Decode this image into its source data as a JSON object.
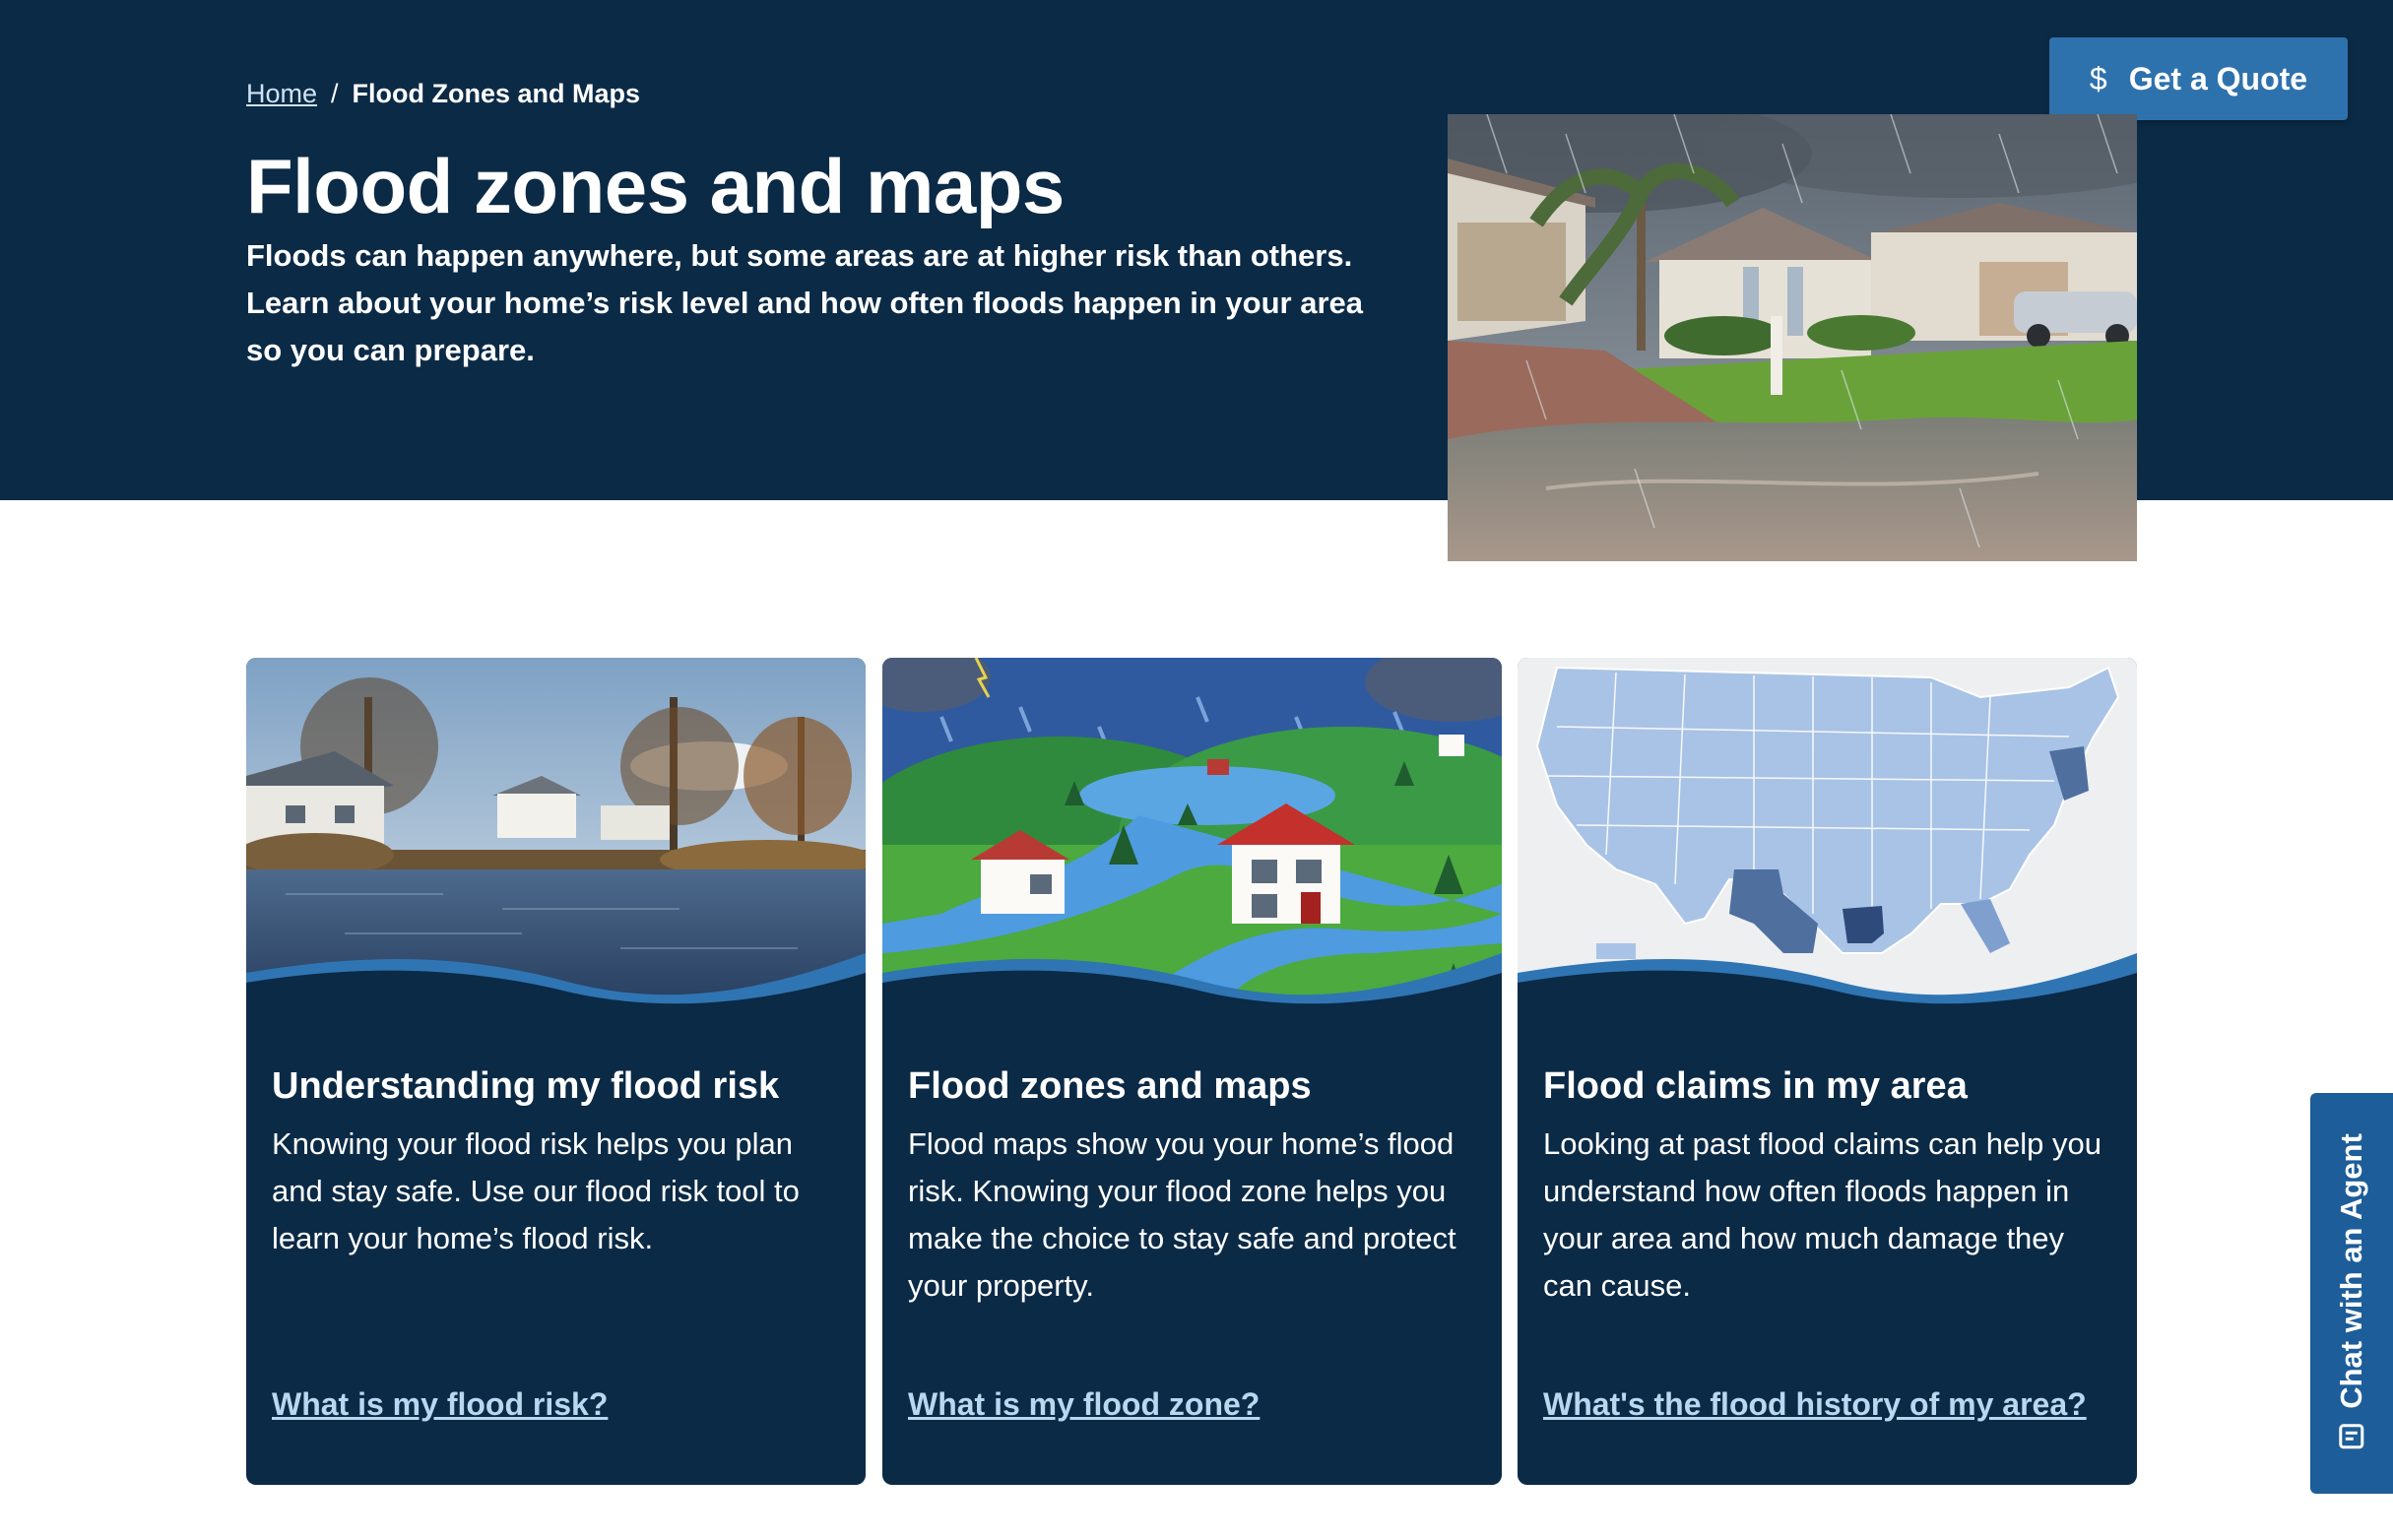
{
  "breadcrumb": {
    "home": "Home",
    "separator": "/",
    "current": "Flood Zones and Maps"
  },
  "hero": {
    "title": "Flood zones and maps",
    "description": "Floods can happen anywhere, but some areas are at higher risk than others. Learn about your home’s risk level and how often floods happen in your area so you can prepare."
  },
  "quote_button": {
    "label": "Get a Quote",
    "icon": "dollar-icon"
  },
  "cards": [
    {
      "title": "Understanding my flood risk",
      "body": "Knowing your flood risk helps you plan and stay safe. Use our flood risk tool to learn your home’s flood risk.",
      "link": "What is my flood risk?"
    },
    {
      "title": "Flood zones and maps",
      "body": "Flood maps show you your home’s flood risk. Knowing your flood zone helps you make the choice to stay safe and protect your property.",
      "link": "What is my flood zone?"
    },
    {
      "title": "Flood claims in my area",
      "body": "Looking at past flood claims can help you understand how often floods happen in your area and how much damage they can cause.",
      "link": "What's the flood history of my area?"
    }
  ],
  "chat": {
    "label": "Chat with an Agent",
    "icon": "chat-icon"
  },
  "colors": {
    "navy": "#0b2a46",
    "accent_blue": "#2e72ad",
    "chat_blue": "#1d5d99",
    "link": "#b9d7ef"
  }
}
